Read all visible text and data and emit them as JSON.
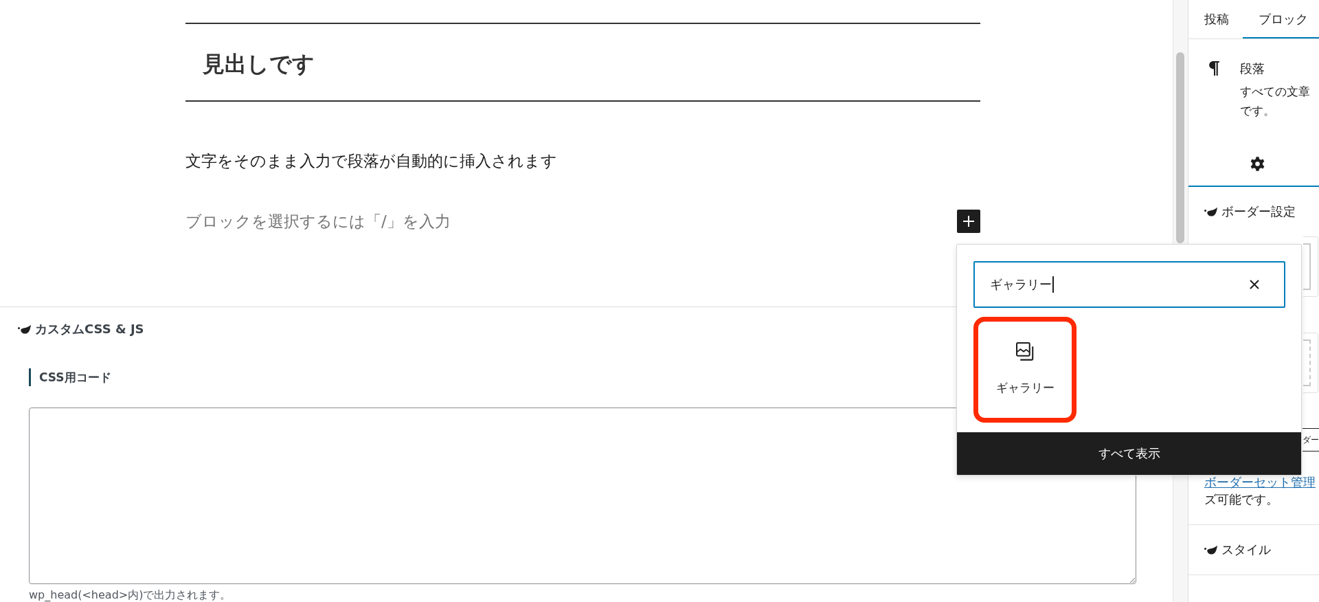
{
  "editor": {
    "heading": "見出しです",
    "paragraph": "文字をそのまま入力で段落が自動的に挿入されます",
    "empty_block": {
      "placeholder": "ブロックを選択するには「/」を入力"
    }
  },
  "inserter": {
    "search": {
      "value": "ギャラリー",
      "focused": true
    },
    "results": [
      {
        "kind": "gallery",
        "label": "ギャラリー",
        "highlighted": true
      }
    ],
    "browse_all": "すべて表示"
  },
  "meta_box": {
    "title": "カスタムCSS & JS",
    "fields": [
      {
        "label": "CSS用コード",
        "help": "wp_head(<head>内)で出力されます。"
      }
    ]
  },
  "sidebar": {
    "tabs": [
      {
        "label": "投稿",
        "selected": false
      },
      {
        "label": "ブロック",
        "selected": true
      }
    ],
    "block_card": {
      "title": "段落",
      "description_lines": [
        "すべての文章",
        "です。"
      ]
    },
    "inspector_tabs": [
      {
        "kind": "settings",
        "selected": true
      }
    ],
    "panels": [
      {
        "title": "ボーダー設定",
        "style_options": [
          {
            "kind": "solid"
          },
          {
            "kind": "dashed"
          }
        ],
        "button": "ダー",
        "link": "ボーダーセット管理",
        "note": "ズ可能です。"
      },
      {
        "title": "スタイル"
      }
    ]
  }
}
